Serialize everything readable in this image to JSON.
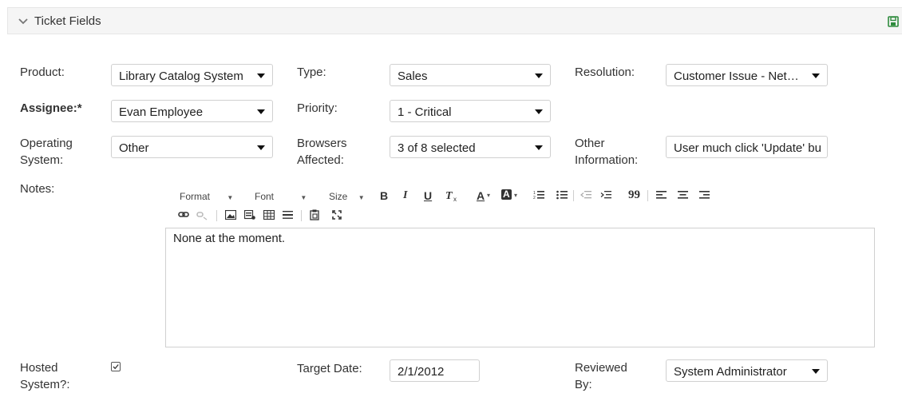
{
  "panel": {
    "title": "Ticket Fields"
  },
  "fields": {
    "product": {
      "label": "Product:",
      "value": "Library Catalog System"
    },
    "type": {
      "label": "Type:",
      "value": "Sales"
    },
    "resolution": {
      "label": "Resolution:",
      "value": "Customer Issue - Net…"
    },
    "assignee": {
      "label": "Assignee:*",
      "value": "Evan Employee"
    },
    "priority": {
      "label": "Priority:",
      "value": "1 - Critical"
    },
    "operating_system": {
      "label_line1": "Operating",
      "label_line2": "System:",
      "value": "Other"
    },
    "browsers": {
      "label_line1": "Browsers",
      "label_line2": "Affected:",
      "value": "3 of 8 selected"
    },
    "other_info": {
      "label_line1": "Other",
      "label_line2": "Information:",
      "value": "User much click 'Update' bu"
    },
    "notes": {
      "label": "Notes:",
      "value": "None at the moment."
    },
    "hosted": {
      "label_line1": "Hosted",
      "label_line2": "System?:",
      "checked": true
    },
    "target_date": {
      "label": "Target Date:",
      "value": "2/1/2012"
    },
    "reviewed_by": {
      "label_line1": "Reviewed",
      "label_line2": "By:",
      "value": "System Administrator"
    }
  },
  "toolbar": {
    "format": "Format",
    "font": "Font",
    "size": "Size",
    "bold": "B",
    "italic": "I",
    "underline": "U",
    "text_color": "A",
    "bg_color": "A",
    "blockquote": "99"
  },
  "colors": {
    "save_icon": "#2e8b3d",
    "header_bg": "#f5f5f5"
  }
}
